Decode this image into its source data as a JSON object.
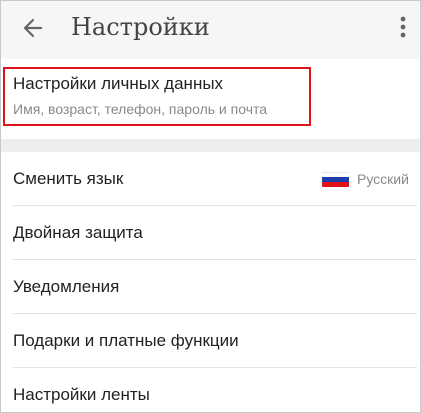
{
  "header": {
    "title": "Настройки"
  },
  "personal": {
    "title": "Настройки личных данных",
    "subtitle": "Имя, возраст, телефон, пароль и почта",
    "highlight_color": "#e0131b"
  },
  "settings": [
    {
      "label": "Сменить язык",
      "value": "Русский",
      "flag": [
        "#ffffff",
        "#1f3fa8",
        "#e0131b"
      ]
    },
    {
      "label": "Двойная защита"
    },
    {
      "label": "Уведомления"
    },
    {
      "label": "Подарки и платные функции"
    },
    {
      "label": "Настройки ленты"
    }
  ],
  "icons": {
    "back": "arrow-back-icon",
    "more": "more-vert-icon",
    "flag": "russia-flag-icon"
  },
  "colors": {
    "text": "#222222",
    "secondary": "#8a8a8a",
    "header_bg": "#f6f6f6",
    "divider": "#e3e3e3"
  }
}
